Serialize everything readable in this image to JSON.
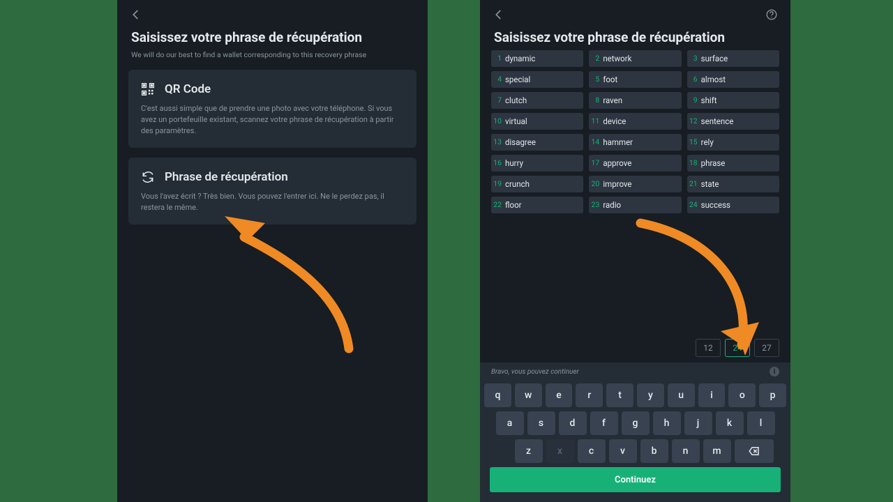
{
  "left": {
    "title": "Saisissez votre phrase de récupération",
    "subtitle": "We will do our best to find a wallet corresponding to this recovery phrase",
    "card_qr": {
      "title": "QR Code",
      "desc": "C'est aussi simple que de prendre une photo avec votre téléphone. Si vous avez un portefeuille existant, scannez votre phrase de récupération à partir des paramètres."
    },
    "card_phrase": {
      "title": "Phrase de récupération",
      "desc": "Vous l'avez écrit ? Très bien. Vous pouvez l'entrer ici. Ne le perdez pas, il restera le même."
    }
  },
  "right": {
    "title": "Saisissez votre phrase de récupération",
    "words": [
      "dynamic",
      "network",
      "surface",
      "special",
      "foot",
      "almost",
      "clutch",
      "raven",
      "shift",
      "virtual",
      "device",
      "sentence",
      "disagree",
      "hammer",
      "rely",
      "hurry",
      "approve",
      "phrase",
      "crunch",
      "improve",
      "state",
      "floor",
      "radio",
      "success"
    ],
    "word_counts": [
      "12",
      "24",
      "27"
    ],
    "word_count_active": "24",
    "hint": "Bravo, vous pouvez continuer",
    "keyboard": {
      "row1": [
        "q",
        "w",
        "e",
        "r",
        "t",
        "y",
        "u",
        "i",
        "o",
        "p"
      ],
      "row2": [
        "a",
        "s",
        "d",
        "f",
        "g",
        "h",
        "j",
        "k",
        "l"
      ],
      "row3": [
        "z",
        "x",
        "c",
        "v",
        "b",
        "n",
        "m"
      ]
    },
    "continue_label": "Continuez"
  }
}
